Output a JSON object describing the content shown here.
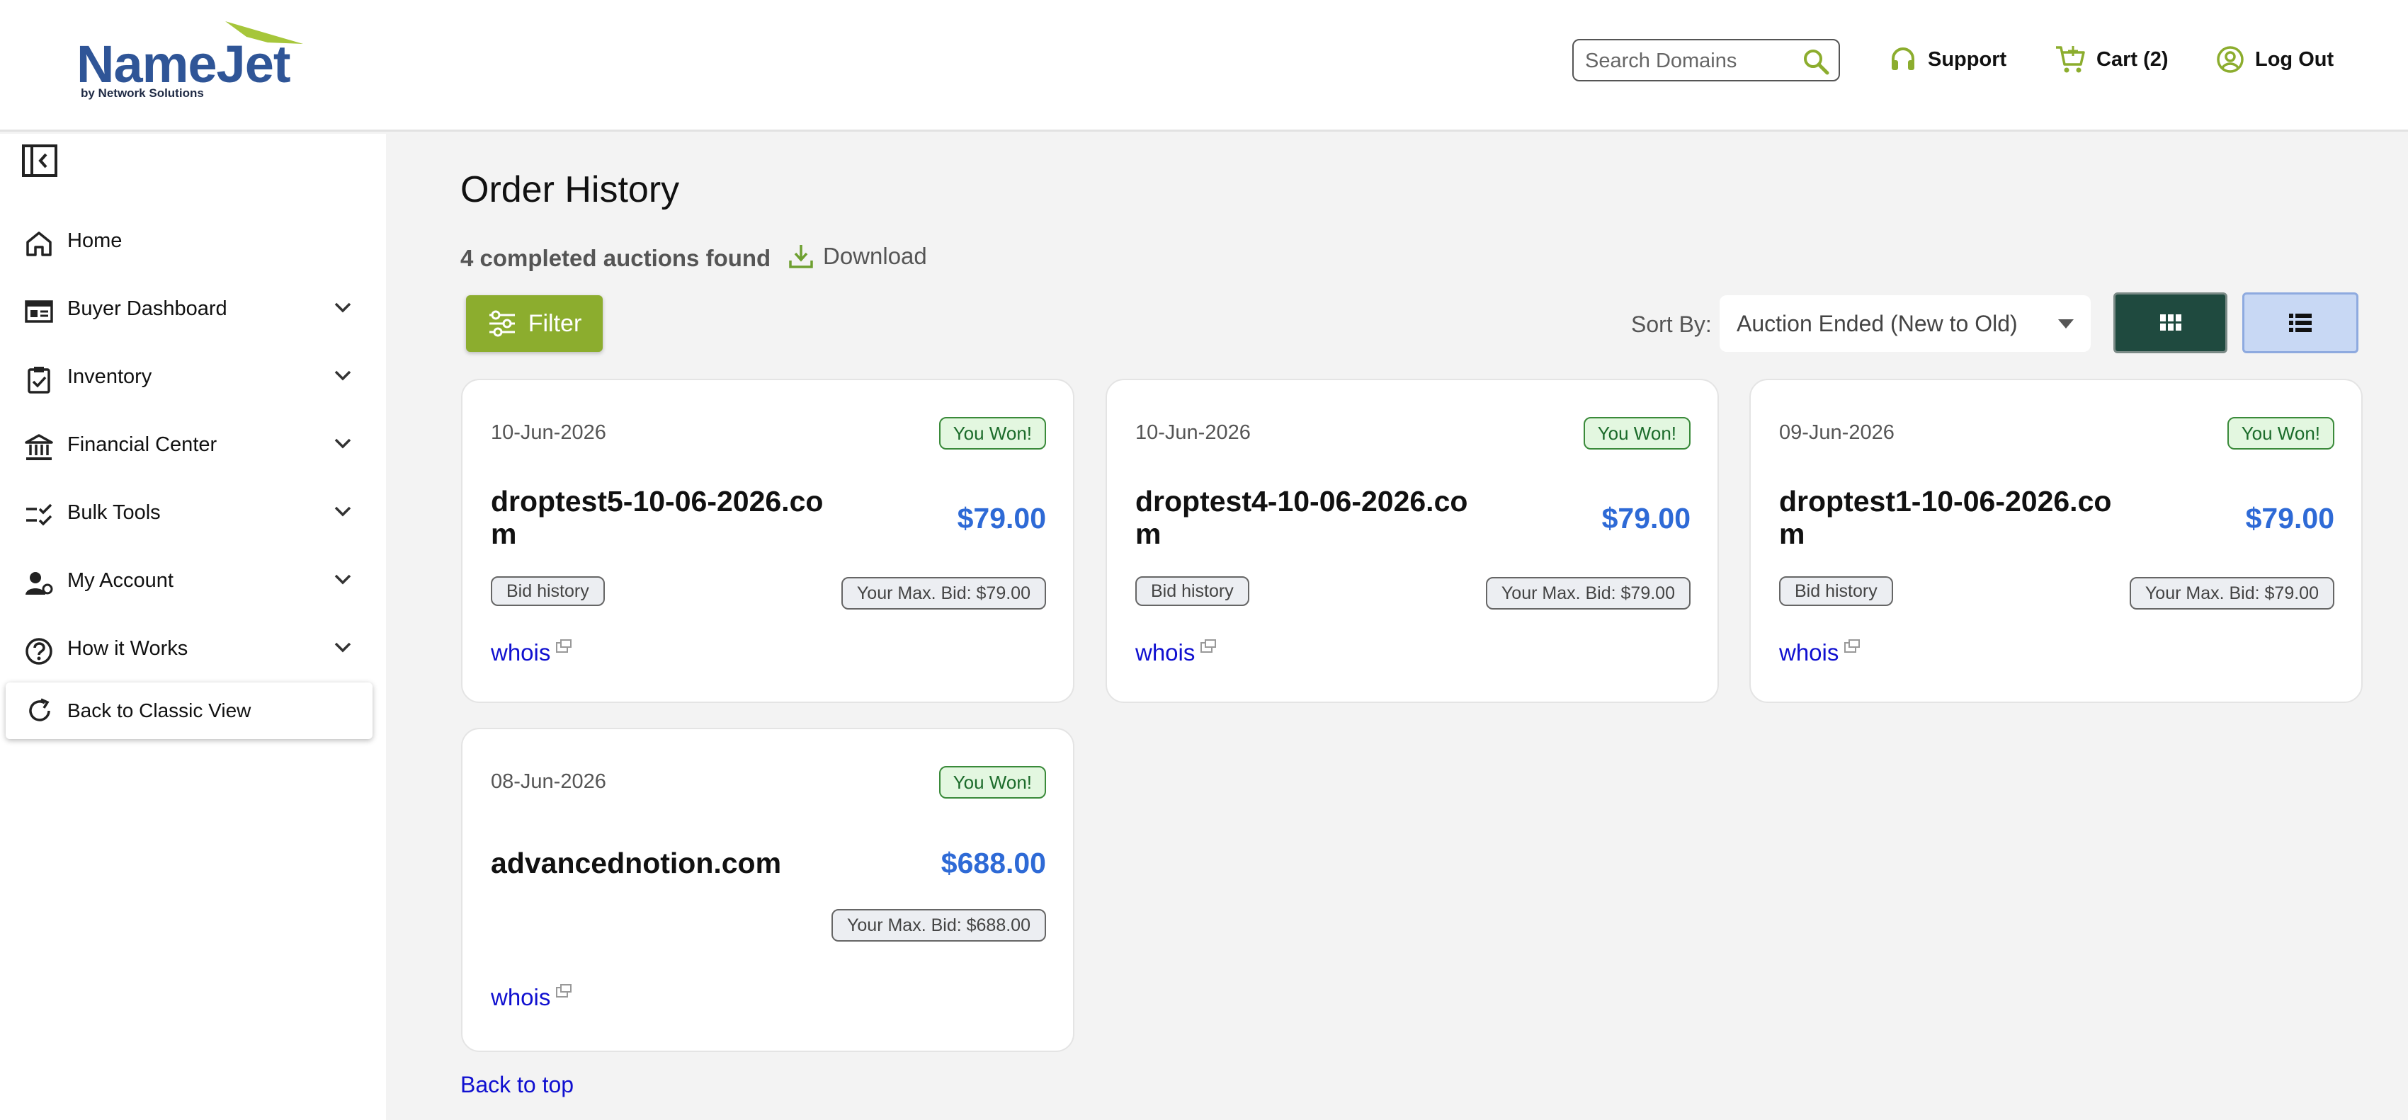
{
  "header": {
    "logo_text": "NameJet",
    "logo_sub": "by Network Solutions",
    "search_placeholder": "Search Domains",
    "support_label": "Support",
    "cart_label": "Cart (2)",
    "logout_label": "Log Out"
  },
  "sidebar": {
    "items": [
      {
        "label": "Home",
        "icon": "home-icon"
      },
      {
        "label": "Buyer Dashboard",
        "icon": "dashboard-icon"
      },
      {
        "label": "Inventory",
        "icon": "clipboard-icon"
      },
      {
        "label": "Financial Center",
        "icon": "bank-icon"
      },
      {
        "label": "Bulk Tools",
        "icon": "checklist-icon"
      },
      {
        "label": "My Account",
        "icon": "account-icon"
      },
      {
        "label": "How it Works",
        "icon": "help-icon"
      }
    ],
    "classic_label": "Back to Classic View"
  },
  "main": {
    "title": "Order History",
    "found_text": "4 completed auctions found",
    "download_label": "Download",
    "filter_label": "Filter",
    "sort_label": "Sort By:",
    "sort_value": "Auction Ended (New to Old)",
    "back_to_top": "Back to top"
  },
  "cards": [
    {
      "date": "10-Jun-2026",
      "status": "You Won!",
      "domain": "droptest5-10-06-2026.com",
      "price": "$79.00",
      "bid_history": "Bid history",
      "max_bid": "Your Max. Bid: $79.00",
      "whois": "whois"
    },
    {
      "date": "10-Jun-2026",
      "status": "You Won!",
      "domain": "droptest4-10-06-2026.com",
      "price": "$79.00",
      "bid_history": "Bid history",
      "max_bid": "Your Max. Bid: $79.00",
      "whois": "whois"
    },
    {
      "date": "09-Jun-2026",
      "status": "You Won!",
      "domain": "droptest1-10-06-2026.com",
      "price": "$79.00",
      "bid_history": "Bid history",
      "max_bid": "Your Max. Bid: $79.00",
      "whois": "whois"
    },
    {
      "date": "08-Jun-2026",
      "status": "You Won!",
      "domain": "advancednotion.com",
      "price": "$688.00",
      "max_bid": "Your Max. Bid: $688.00",
      "whois": "whois"
    }
  ],
  "colors": {
    "brand_blue": "#2f5597",
    "brand_green": "#8cad2e",
    "price_blue": "#2e6ad6",
    "won_green": "#1b6b2a",
    "link_blue": "#1010d0"
  }
}
